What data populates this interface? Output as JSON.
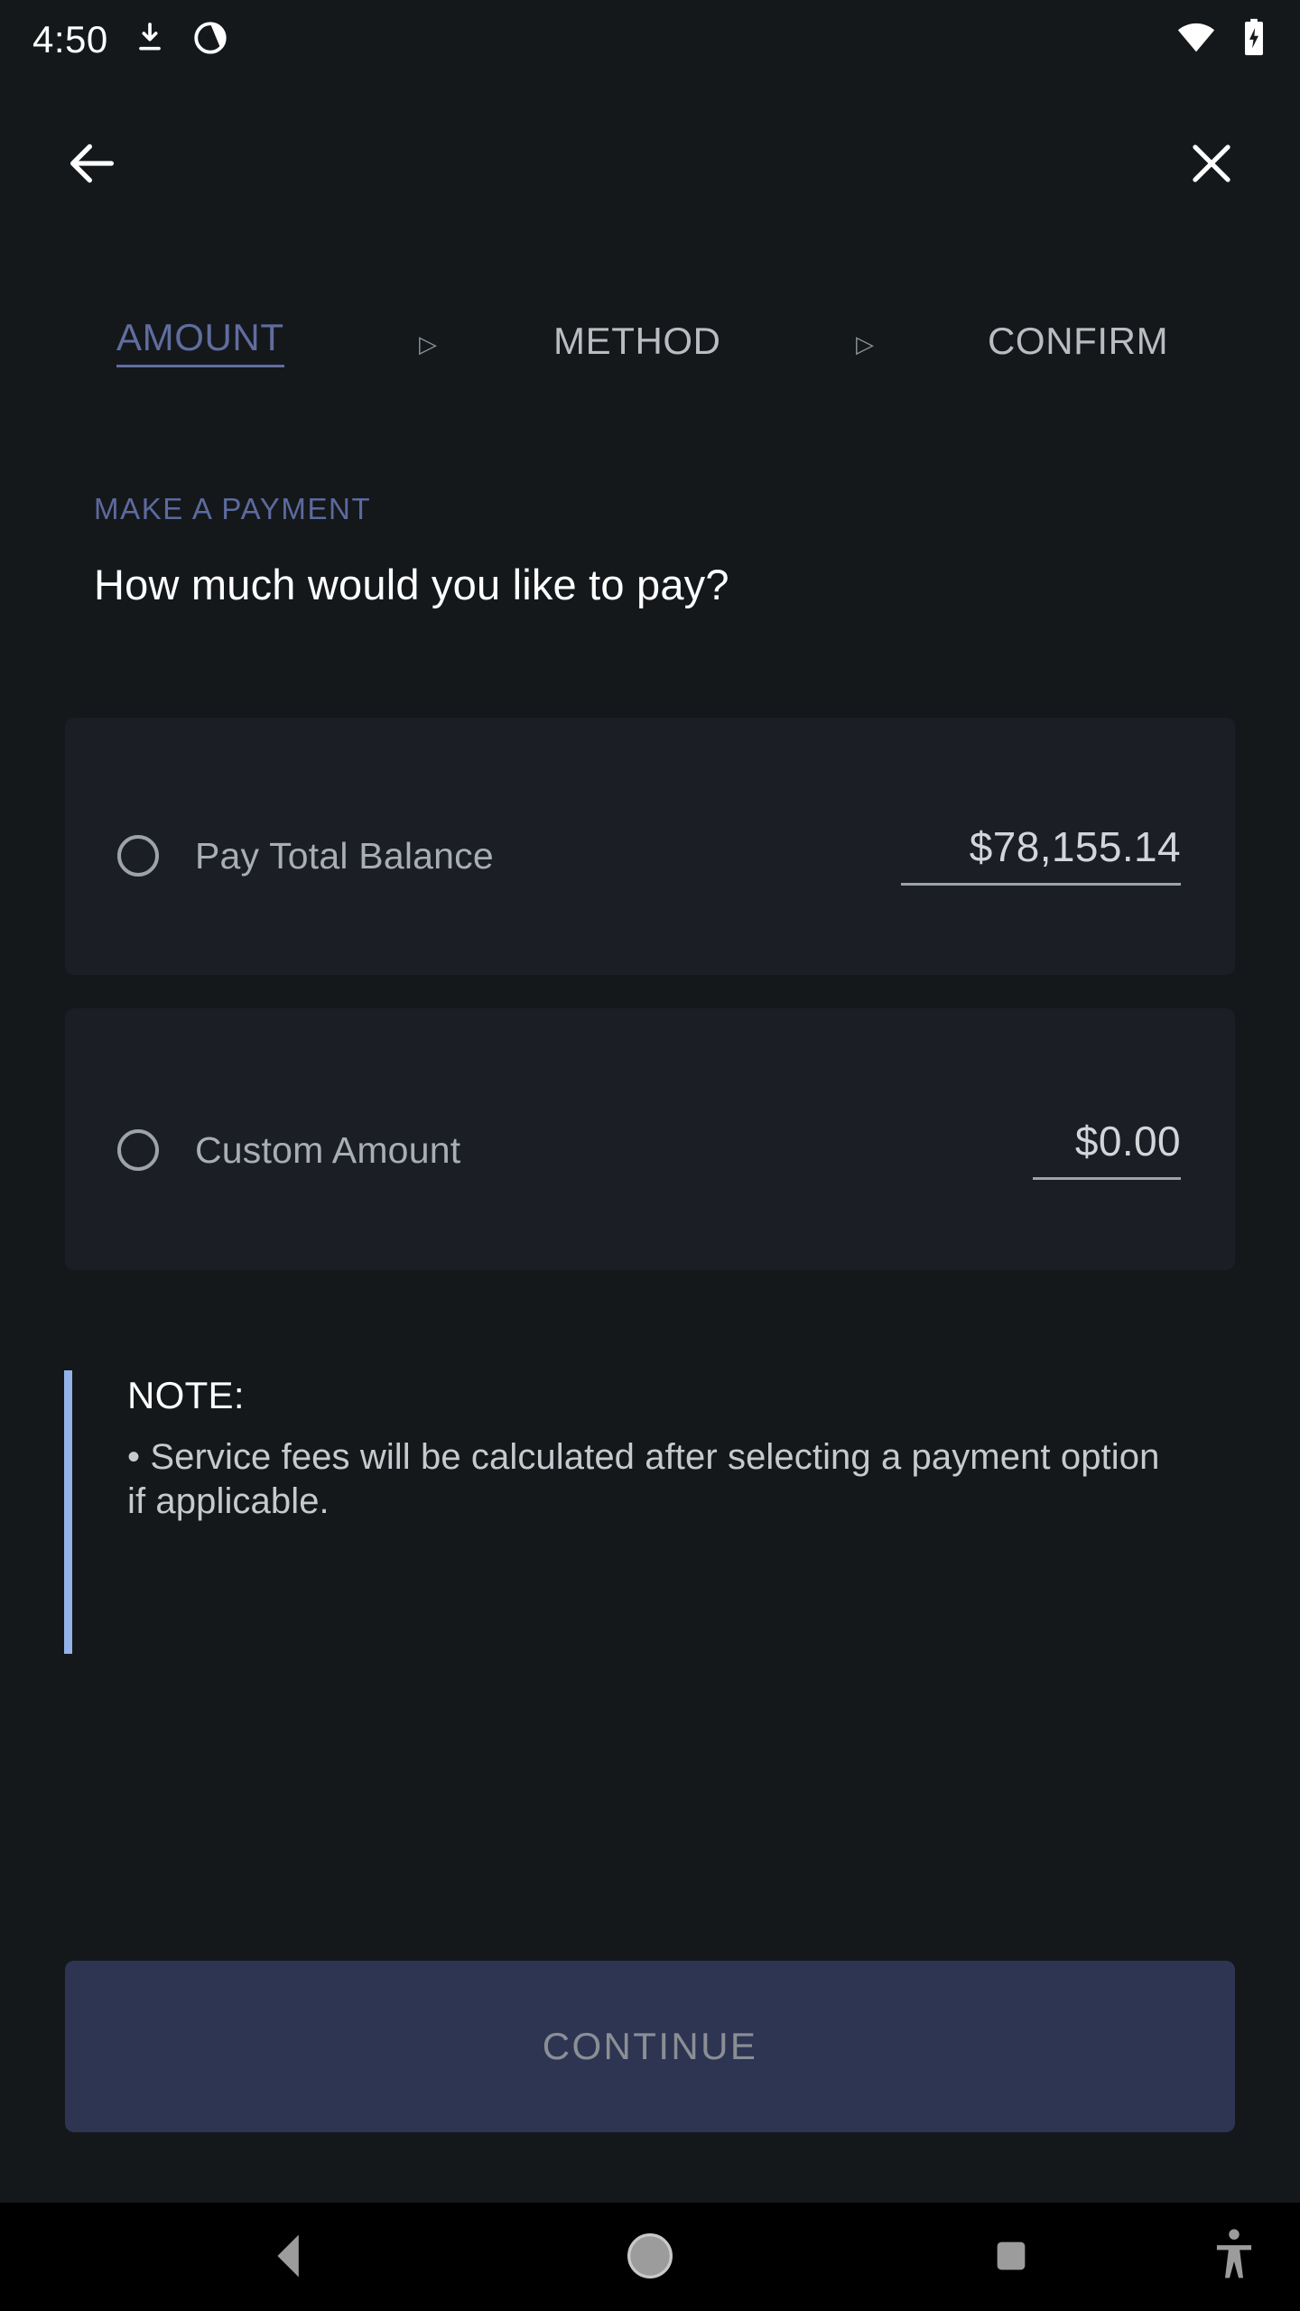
{
  "status_bar": {
    "time": "4:50",
    "icons": [
      "download-icon",
      "do-not-disturb-icon",
      "wifi-icon",
      "battery-charging-icon"
    ]
  },
  "appbar": {
    "back_label": "back-arrow-icon",
    "close_label": "close-icon"
  },
  "stepper": {
    "steps": [
      {
        "label": "AMOUNT",
        "active": true
      },
      {
        "label": "METHOD",
        "active": false
      },
      {
        "label": "CONFIRM",
        "active": false
      }
    ],
    "separator": "▷",
    "active_color": "#606d9f",
    "inactive_color": "#b9bdc1"
  },
  "header": {
    "eyebrow": "MAKE A PAYMENT",
    "eyebrow_color": "#5d6a9e",
    "title": "How much would you like to pay?"
  },
  "options": [
    {
      "label": "Pay Total Balance",
      "amount": "$78,155.14",
      "selected": false
    },
    {
      "label": "Custom Amount",
      "amount": "$0.00",
      "selected": false
    }
  ],
  "note": {
    "title": "NOTE:",
    "body": "• Service fees will be calculated after selecting a payment option if applicable.",
    "accent_color": "#93b4ea"
  },
  "footer": {
    "continue_label": "CONTINUE",
    "continue_bg": "#2e3553",
    "continue_text_color": "#8b8f94"
  },
  "navbar": {
    "back": "nav-back-icon",
    "home": "nav-home-icon",
    "recents": "nav-recents-icon",
    "accessibility": "nav-accessibility-icon"
  },
  "theme": {
    "page_bg": "#14181b",
    "card_bg": "#1b1f25"
  }
}
